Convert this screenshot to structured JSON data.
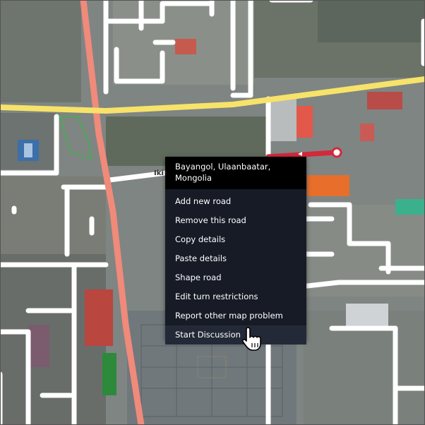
{
  "context_menu": {
    "location": "Bayangol, Ulaanbaatar, Mongolia",
    "items": [
      {
        "label": "Add new road"
      },
      {
        "label": "Remove this road"
      },
      {
        "label": "Copy details"
      },
      {
        "label": "Paste details"
      },
      {
        "label": "Shape road"
      },
      {
        "label": "Edit turn restrictions"
      },
      {
        "label": "Report other map problem"
      },
      {
        "label": "Start Discussion"
      }
    ]
  },
  "map": {
    "road_label": "Iki",
    "colors": {
      "primary_road": "#f7e36a",
      "trunk_road": "#f08a7a",
      "selected_road": "#d3293b",
      "minor_road": "#ffffff",
      "path": "#2fbf3a"
    }
  }
}
